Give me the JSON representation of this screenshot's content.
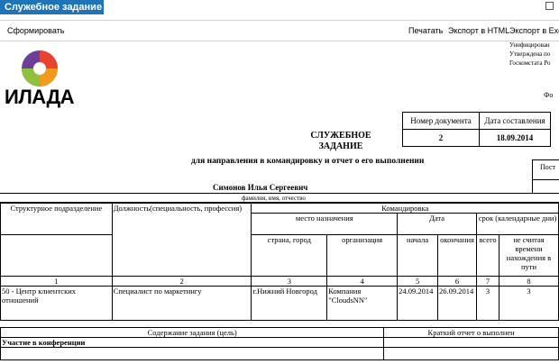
{
  "window": {
    "title": "Служебное задание"
  },
  "toolbar": {
    "generate": "Сформировать",
    "print": "Печатать",
    "export_html": "Экспорт в HTML",
    "export_excel": "Экспорт в Exce"
  },
  "logo": {
    "text": "ИЛАДА",
    "colors": [
      "#e8432e",
      "#f29a1d",
      "#8fc13e",
      "#6c3e98"
    ]
  },
  "form_info": {
    "line1": "Унифицирован",
    "line2": "Утверждена по",
    "line3": "Госкомстата Ро",
    "form_label": "Фо"
  },
  "doc_number": {
    "header_number": "Номер документа",
    "header_date": "Дата составления",
    "number": "2",
    "date": "18.09.2014"
  },
  "title": {
    "line1": "СЛУЖЕБНОЕ",
    "line2": "ЗАДАНИЕ",
    "subtitle": "для направления в командировку и отчет о его выполнении"
  },
  "side_label": "Пост",
  "employee": {
    "name": "Симонов Илья Сергеевич",
    "caption": "фамилия, имя, отчество"
  },
  "table": {
    "h_structural": "Структурное подразделение",
    "h_position": "Должность(специальность, профессия)",
    "h_trip": "Командировка",
    "h_destination": "место назначения",
    "h_date": "Дата",
    "h_term": "срок (календарные дни)",
    "h_country": "страна, город",
    "h_org": "организация",
    "h_start": "начала",
    "h_end": "окончания",
    "h_total": "всего",
    "h_excl": "не считая времени нахождения в пути",
    "nums": [
      "1",
      "2",
      "3",
      "4",
      "5",
      "6",
      "7",
      "8"
    ],
    "row": {
      "department": "50 - Центр клиентских отношений",
      "position": "Специалист по маркетингу",
      "city": "г.Нижний Новгород",
      "org": "Компания \"CloudsNN\"",
      "start": "24.09.2014",
      "end": "26.09.2014",
      "total": "3",
      "excl": "3"
    }
  },
  "tasks": {
    "h_content": "Содержание задания (цель)",
    "h_report": "Краткий отчет о выполнен",
    "item1": "Участие в конференции"
  }
}
